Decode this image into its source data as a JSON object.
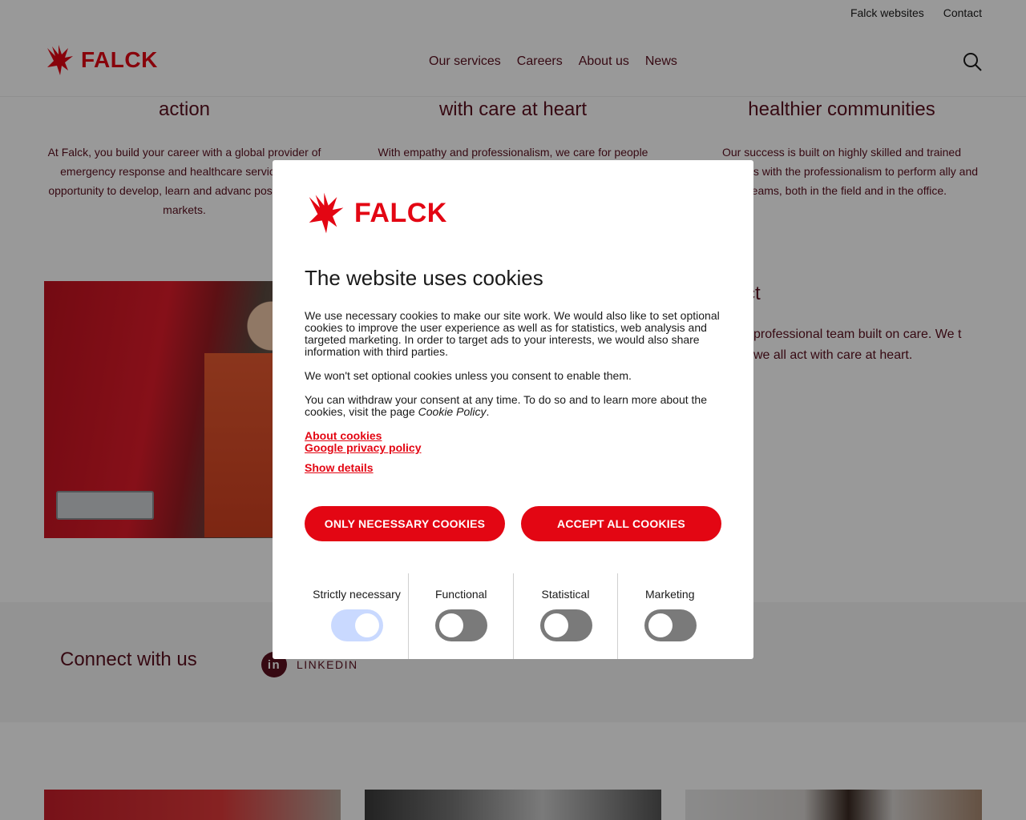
{
  "top_links": [
    "Falck websites",
    "Contact"
  ],
  "brand": {
    "name": "FALCK",
    "color": "#e30613",
    "icon": "eagle-logo-icon"
  },
  "nav": [
    "Our services",
    "Careers",
    "About us",
    "News"
  ],
  "columns": [
    {
      "title": "action",
      "text": "At Falck, you build your career with a global provider of emergency response and healthcare services. the opportunity to develop, learn and advanc positions and markets."
    },
    {
      "title": "with care at heart",
      "text": "With empathy and professionalism, we care for people"
    },
    {
      "title": "healthier communities",
      "text": "Our success is built on highly skilled and trained colleagues with the professionalism to perform ally and in teams, both in the field and in the office."
    }
  ],
  "right_block": {
    "title": "ct",
    "text": "professional team built on care. We t we all act with care at heart."
  },
  "connect": {
    "title": "Connect with us",
    "linkedin_label": "LINKEDIN"
  },
  "cookie_modal": {
    "title": "The website uses cookies",
    "paragraphs": [
      "We use necessary cookies to make our site work. We would also like to set optional cookies to improve the user experience as well as for statistics, web analysis and targeted marketing. In order to target ads to your interests, we would also share information with third parties.",
      "We won't set optional cookies unless you consent to enable them."
    ],
    "withdraw_prefix": "You can withdraw your consent at any time. To do so and to learn more about the cookies, visit the page ",
    "withdraw_link": "Cookie Policy",
    "withdraw_suffix": ".",
    "links": [
      "About cookies",
      "Google privacy policy",
      "Show details"
    ],
    "btn_necessary": "ONLY NECESSARY COOKIES",
    "btn_accept": "ACCEPT ALL COOKIES",
    "toggles": [
      {
        "label": "Strictly necessary",
        "on": true
      },
      {
        "label": "Functional",
        "on": false
      },
      {
        "label": "Statistical",
        "on": false
      },
      {
        "label": "Marketing",
        "on": false
      }
    ]
  }
}
